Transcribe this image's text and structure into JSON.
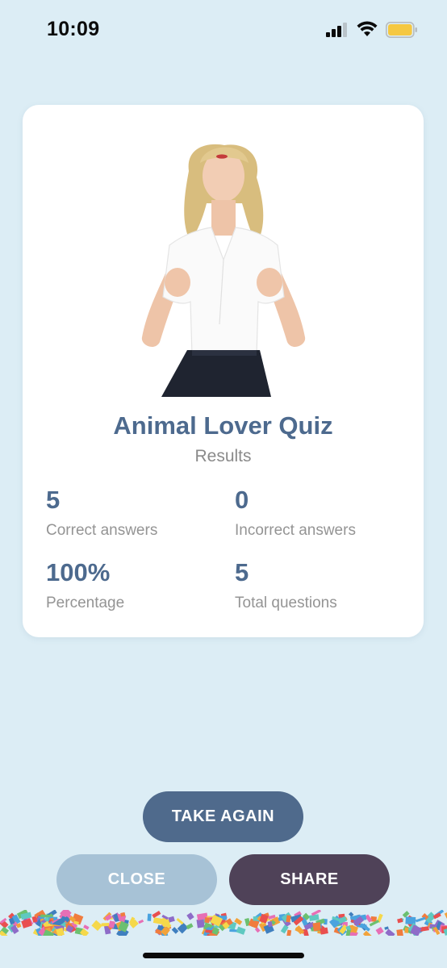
{
  "status": {
    "time": "10:09",
    "icons": [
      "cellular-signal-icon",
      "wifi-icon",
      "battery-icon"
    ],
    "battery_color": "#f5c842"
  },
  "card": {
    "image": "celebrating-woman-image",
    "title": "Animal Lover Quiz",
    "subtitle": "Results",
    "stats": [
      {
        "value": "5",
        "label": "Correct answers"
      },
      {
        "value": "0",
        "label": "Incorrect answers"
      },
      {
        "value": "100%",
        "label": "Percentage"
      },
      {
        "value": "5",
        "label": "Total questions"
      }
    ]
  },
  "actions": {
    "take_again": "TAKE AGAIN",
    "close": "CLOSE",
    "share": "SHARE"
  },
  "colors": {
    "background": "#dcedf5",
    "accent": "#4d6a8e",
    "take_again_bg": "#4f6a8c",
    "close_bg": "#a7c2d6",
    "share_bg": "#4f4258"
  }
}
